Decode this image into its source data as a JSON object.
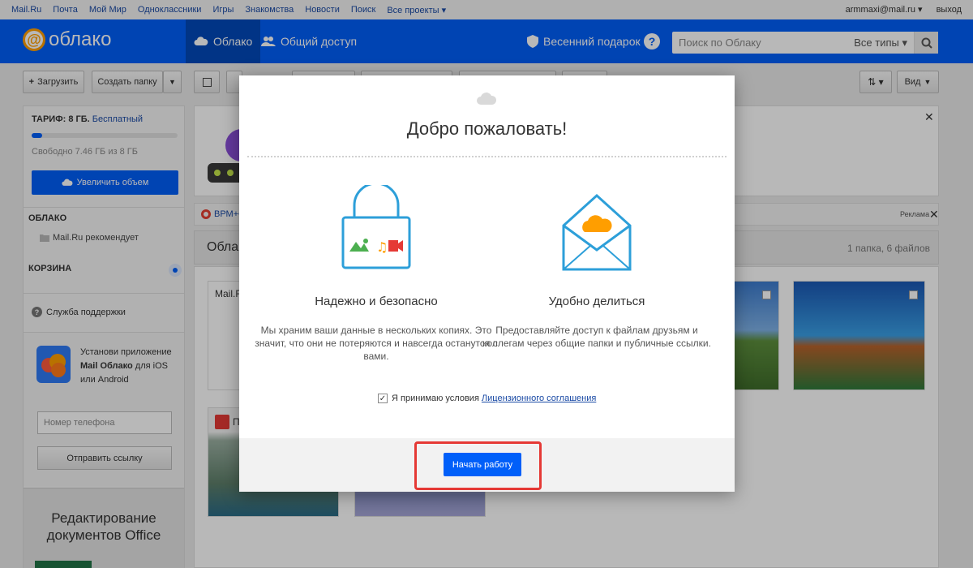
{
  "portal": {
    "links": [
      "Mail.Ru",
      "Почта",
      "Мой Мир",
      "Одноклассники",
      "Игры",
      "Знакомства",
      "Новости",
      "Поиск",
      "Все проекты ▾"
    ],
    "user": "armmaxi@mail.ru ▾",
    "logout": "выход"
  },
  "header": {
    "logo": "облако",
    "tab_cloud": "Облако",
    "tab_shared": "Общий доступ",
    "gift": "Весенний подарок",
    "help": "?",
    "search_placeholder": "Поиск по Облаку",
    "search_types": "Все типы ▾"
  },
  "toolbar": {
    "upload": "Загрузить",
    "create_folder": "Создать папку",
    "view": "Вид"
  },
  "sidebar": {
    "tarif_label": "ТАРИФ: 8 ГБ.",
    "tarif_plan": "Бесплатный",
    "storage_used_fraction": 0.07,
    "free_space": "Свободно 7.46 ГБ из 8 ГБ",
    "increase_button": "Увеличить объем",
    "section_cloud": "ОБЛАКО",
    "folder_recommended": "Mail.Ru рекомендует",
    "section_trash": "КОРЗИНА",
    "support": "Служба поддержки",
    "promo_text_1": "Установи приложение",
    "promo_text_bold": "Mail Облако",
    "promo_text_2": "для iOS или Android",
    "phone_placeholder": "Номер телефона",
    "send_link": "Отправить ссылку",
    "office_promo": "Редактирование документов Office"
  },
  "main": {
    "ad_label": "ВРМ+О",
    "ad_reklama": "Реклама",
    "folder_title": "Облак",
    "folder_count": "1 папка, 6 файлов",
    "tile_label": "Mail.R",
    "tile_label2": "П"
  },
  "modal": {
    "title": "Добро пожаловать!",
    "feature1_title": "Надежно и безопасно",
    "feature1_text": "Мы храним ваши данные в нескольких копиях. Это значит, что они не потеряются и навсегда останутся с вами.",
    "feature2_title": "Удобно делиться",
    "feature2_text": "Предоставляйте доступ к файлам друзьям и коллегам через общие папки и публичные ссылки.",
    "agree_text": "Я принимаю условия",
    "agree_link": "Лицензионного соглашения",
    "start_button": "Начать работу"
  },
  "colors": {
    "brand_blue": "#005ff9",
    "accent_orange": "#ff9e00",
    "highlight_red": "#e53935"
  }
}
